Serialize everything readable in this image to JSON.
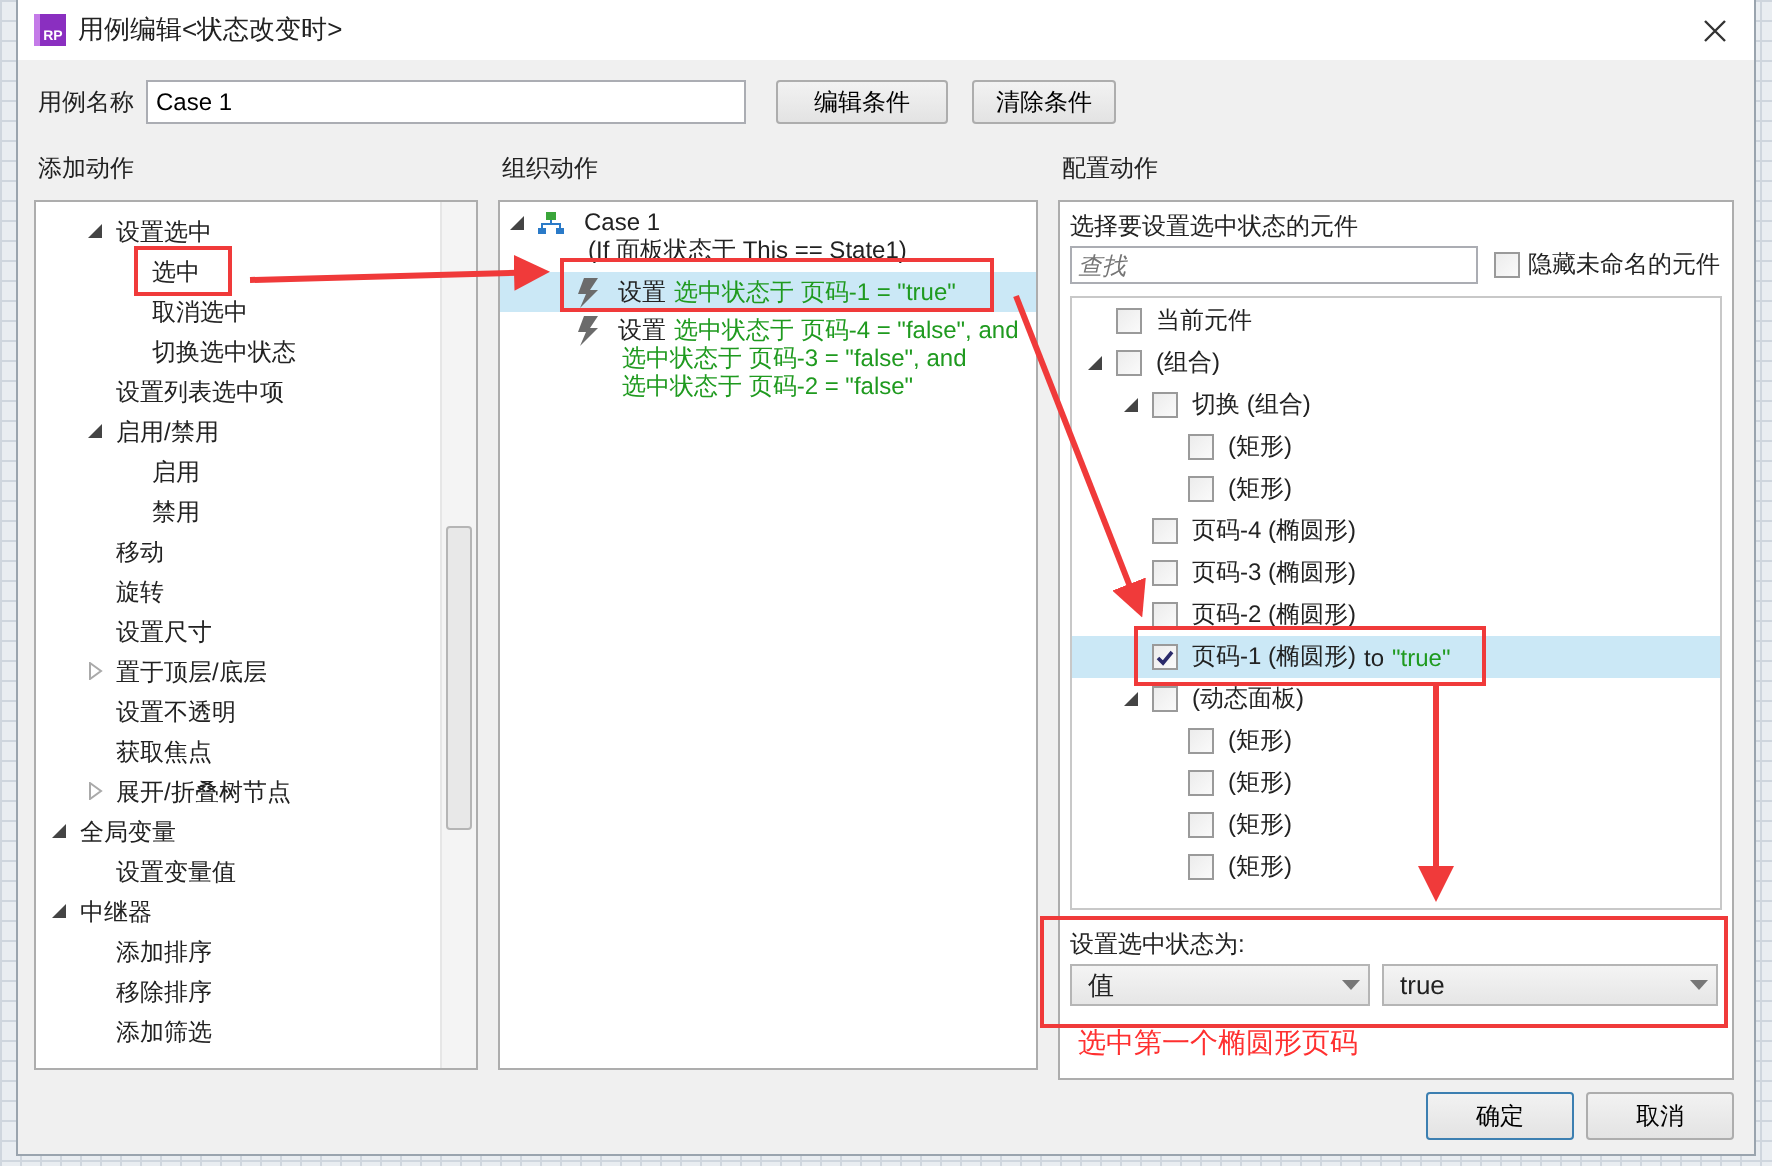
{
  "window": {
    "icon_text": "RP",
    "title": "用例编辑<状态改变时>"
  },
  "case_name": {
    "label": "用例名称",
    "value": "Case 1"
  },
  "toolbar_buttons": [
    "编辑条件",
    "清除条件"
  ],
  "add_actions": {
    "title": "添加动作",
    "continued_items": [
      {
        "label": "设置选中",
        "expanded": true,
        "children": [
          {
            "label": "选中"
          },
          {
            "label": "取消选中"
          },
          {
            "label": "切换选中状态"
          }
        ]
      },
      {
        "label": "设置列表选中项"
      },
      {
        "label": "启用/禁用",
        "expanded": true,
        "children": [
          {
            "label": "启用"
          },
          {
            "label": "禁用"
          }
        ]
      },
      {
        "label": "移动"
      },
      {
        "label": "旋转"
      },
      {
        "label": "设置尺寸"
      },
      {
        "label": "置于顶层/底层",
        "expanded": false
      },
      {
        "label": "设置不透明"
      },
      {
        "label": "获取焦点"
      },
      {
        "label": "展开/折叠树节点",
        "expanded": false
      }
    ],
    "items": [
      {
        "label": "全局变量",
        "expanded": true,
        "children": [
          {
            "label": "设置变量值"
          }
        ]
      },
      {
        "label": "中继器",
        "expanded": true,
        "children": [
          {
            "label": "添加排序"
          },
          {
            "label": "移除排序"
          },
          {
            "label": "添加筛选"
          }
        ]
      }
    ]
  },
  "organize_actions": {
    "title": "组织动作",
    "case": {
      "name": "Case 1",
      "condition": "(If 面板状态于 This == State1)",
      "expanded": true,
      "actions": [
        {
          "verb": "设置",
          "lines": [
            "选中状态于 页码-1 = \"true\""
          ],
          "selected": true
        },
        {
          "verb": "设置",
          "lines": [
            "选中状态于 页码-4 = \"false\", and",
            "选中状态于 页码-3 = \"false\", and",
            "选中状态于 页码-2 = \"false\""
          ],
          "selected": false
        }
      ]
    }
  },
  "configure_actions": {
    "title": "配置动作",
    "prompt": "选择要设置选中状态的元件",
    "search": {
      "placeholder": "查找"
    },
    "hide_unnamed": {
      "label": "隐藏未命名的元件",
      "checked": false
    },
    "widgets": [
      {
        "label": "当前元件",
        "checked": false,
        "selected": false
      },
      {
        "label": "(组合)",
        "checked": false,
        "selected": false,
        "expanded": true,
        "children": [
          {
            "label": "切换 (组合)",
            "checked": false,
            "selected": false,
            "expanded": true,
            "children": [
              {
                "label": "(矩形)",
                "checked": false,
                "selected": false
              },
              {
                "label": "(矩形)",
                "checked": false,
                "selected": false
              }
            ]
          },
          {
            "label": "页码-4 (椭圆形)",
            "checked": false,
            "selected": false
          },
          {
            "label": "页码-3 (椭圆形)",
            "checked": false,
            "selected": false
          },
          {
            "label": "页码-2 (椭圆形)",
            "checked": false,
            "selected": false
          },
          {
            "label": "页码-1 (椭圆形)",
            "checked": true,
            "selected": true,
            "assignment": "to",
            "assigned_value": "\"true\""
          },
          {
            "label": "(动态面板)",
            "checked": false,
            "selected": false,
            "expanded": true,
            "children": [
              {
                "label": "(矩形)",
                "checked": false,
                "selected": false
              },
              {
                "label": "(矩形)",
                "checked": false,
                "selected": false
              },
              {
                "label": "(矩形)",
                "checked": false,
                "selected": false
              },
              {
                "label": "(矩形)",
                "checked": false,
                "selected": false
              }
            ]
          }
        ]
      }
    ],
    "set_state": {
      "label": "设置选中状态为:",
      "mode": "值",
      "value": "true"
    },
    "note": "选中第一个椭圆形页码"
  },
  "footer_buttons": [
    {
      "label": "确定",
      "default": true
    },
    {
      "label": "取消",
      "default": false
    }
  ]
}
